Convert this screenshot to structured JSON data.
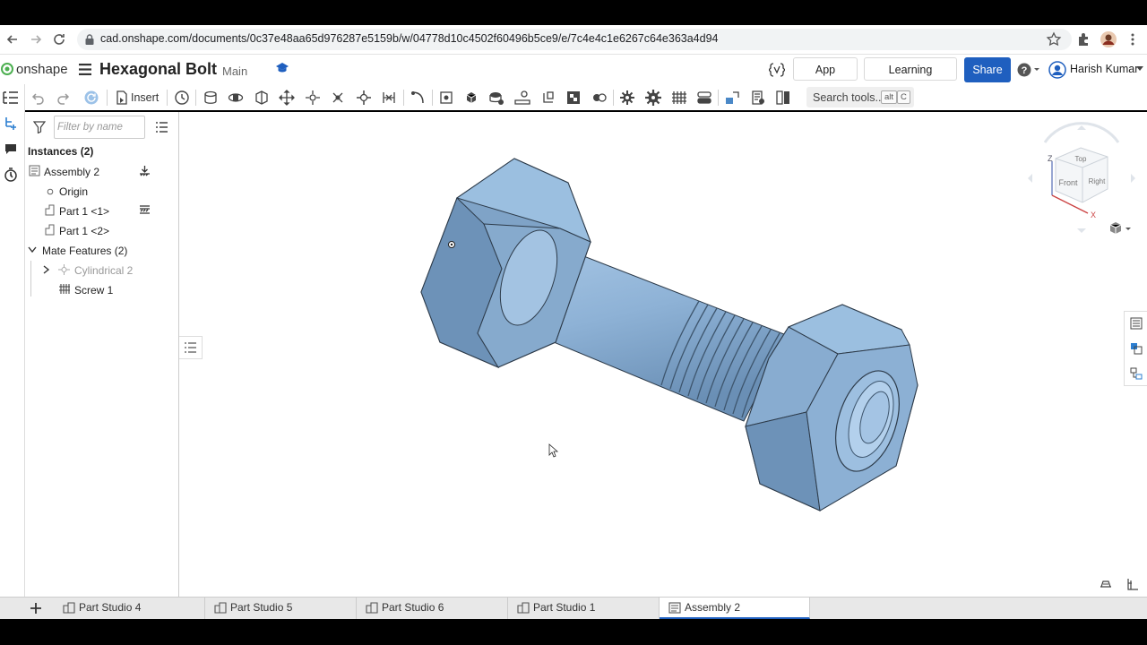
{
  "browser": {
    "url": "cad.onshape.com/documents/0c37e48aa65d976287e5159b/w/04778d10c4502f60496b5ce9/e/7c4e4c1e6267c64e363a4d94"
  },
  "header": {
    "logo": "onshape",
    "doc_title": "Hexagonal Bolt",
    "branch": "Main",
    "app_store": "App Store",
    "learning_center": "Learning Center",
    "share": "Share",
    "user_name": "Harish Kumar"
  },
  "toolbar": {
    "insert_label": "Insert",
    "search_label": "Search tools...",
    "search_kbd_1": "alt",
    "search_kbd_2": "C"
  },
  "panel": {
    "filter_placeholder": "Filter by name",
    "instances_header": "Instances (2)",
    "items": [
      {
        "label": "Assembly 2"
      },
      {
        "label": "Origin"
      },
      {
        "label": "Part 1 <1>"
      },
      {
        "label": "Part 1 <2>"
      }
    ],
    "mate_header": "Mate Features (2)",
    "mates": [
      {
        "label": "Cylindrical 2"
      },
      {
        "label": "Screw 1"
      }
    ]
  },
  "viewcube": {
    "top": "Top",
    "front": "Front",
    "right": "Right",
    "z": "Z",
    "x": "X"
  },
  "tabs": [
    {
      "label": "Part Studio 4"
    },
    {
      "label": "Part Studio 5"
    },
    {
      "label": "Part Studio 6"
    },
    {
      "label": "Part Studio 1"
    },
    {
      "label": "Assembly 2"
    }
  ],
  "colors": {
    "accent": "#1f5fbf",
    "model": "#8fb3d6"
  }
}
